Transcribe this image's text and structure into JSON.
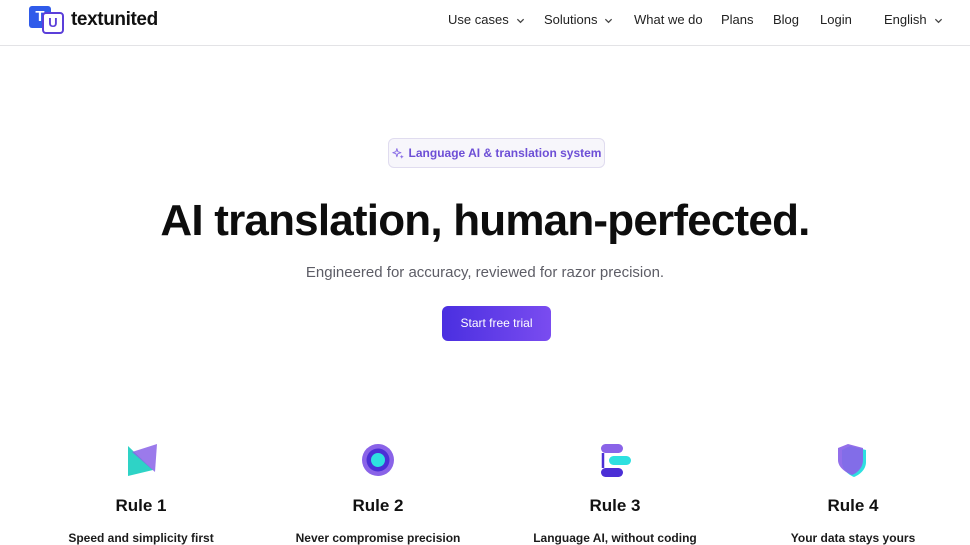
{
  "brand": {
    "name": "textunited",
    "logo_t": "T",
    "logo_u": "U",
    "primary": "#2f5bea",
    "accent": "#5b3fd9"
  },
  "nav": {
    "items": [
      {
        "label": "Use cases",
        "dropdown": true
      },
      {
        "label": "Solutions",
        "dropdown": true
      },
      {
        "label": "What we do",
        "dropdown": false
      },
      {
        "label": "Plans",
        "dropdown": false
      },
      {
        "label": "Blog",
        "dropdown": false
      },
      {
        "label": "Login",
        "dropdown": false
      }
    ],
    "language": {
      "label": "English",
      "dropdown": true
    }
  },
  "hero": {
    "badge": {
      "icon": "sparkles-icon",
      "label": "Language AI & translation system"
    },
    "title": "AI translation, human-perfected.",
    "subtitle": "Engineered for accuracy, reviewed for razor precision.",
    "cta_label": "Start free trial",
    "cta_gradient": [
      "#4a2fe0",
      "#7a4cf0"
    ]
  },
  "rules": [
    {
      "title": "Rule 1",
      "desc": "Speed and simplicity first",
      "icon": "speed-shape-icon"
    },
    {
      "title": "Rule 2",
      "desc": "Never compromise precision",
      "icon": "precision-ring-icon"
    },
    {
      "title": "Rule 3",
      "desc": "Language AI, without coding",
      "icon": "flow-icon"
    },
    {
      "title": "Rule 4",
      "desc": "Your data stays yours",
      "icon": "shield-icon"
    }
  ]
}
